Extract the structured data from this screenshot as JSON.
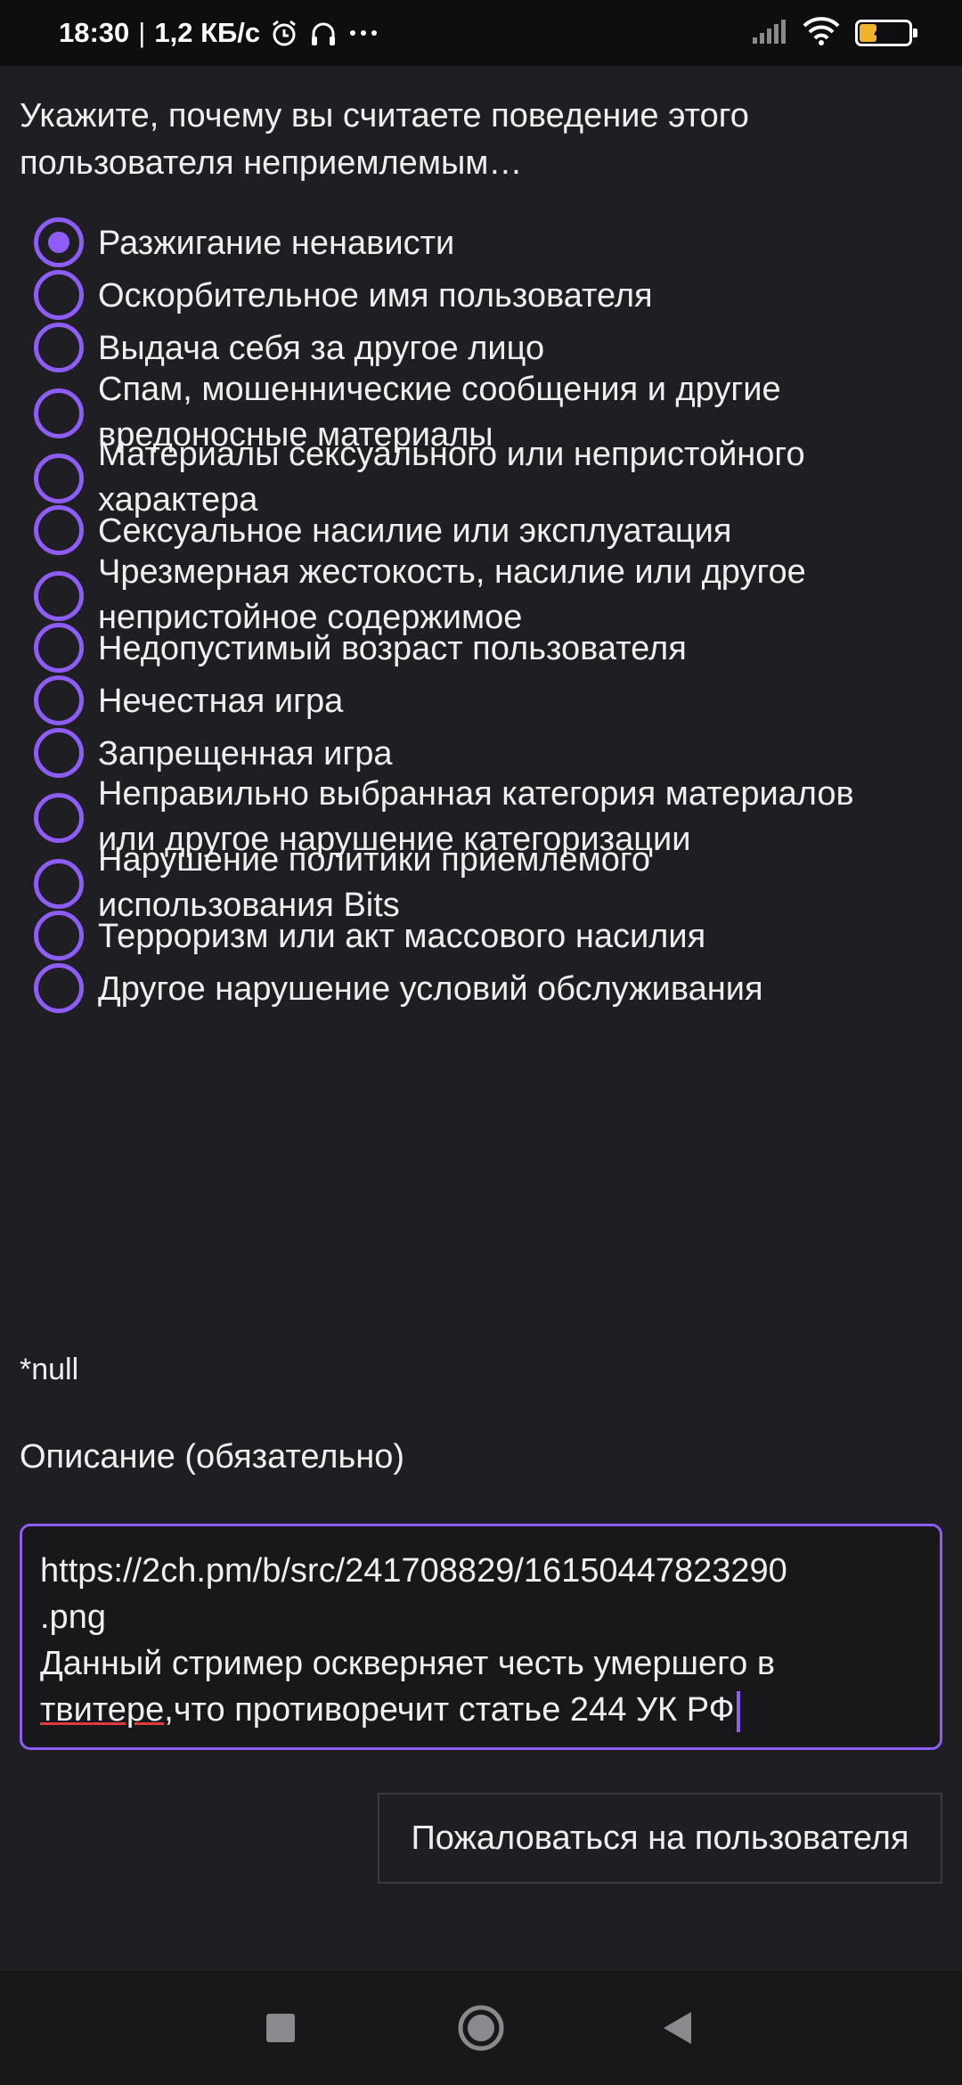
{
  "status_bar": {
    "time": "18:30",
    "network_speed": "1,2 КБ/с",
    "battery_level": "40",
    "battery_fraction": 0.4
  },
  "prompt": {
    "line1": "Укажите, почему вы считаете поведение этого",
    "line2": "пользователя неприемлемым…"
  },
  "options": [
    {
      "label": "Разжигание ненависти",
      "checked": true
    },
    {
      "label": "Оскорбительное имя пользователя",
      "checked": false
    },
    {
      "label": "Выдача себя за другое лицо",
      "checked": false
    },
    {
      "label_line1": "Спам, мошеннические сообщения и другие",
      "label_line2": "вредоносные материалы",
      "checked": false
    },
    {
      "label_line1": "Материалы сексуального или непристойного",
      "label_line2": "характера",
      "checked": false
    },
    {
      "label": "Сексуальное насилие или эксплуатация",
      "checked": false
    },
    {
      "label_line1": "Чрезмерная жестокость, насилие или другое",
      "label_line2": "непристойное содержимое",
      "checked": false
    },
    {
      "label": "Недопустимый возраст пользователя",
      "checked": false
    },
    {
      "label": "Нечестная игра",
      "checked": false
    },
    {
      "label": "Запрещенная игра",
      "checked": false
    },
    {
      "label_line1": "Неправильно выбранная категория материалов",
      "label_line2": "или другое нарушение категоризации",
      "checked": false
    },
    {
      "label_line1": "Нарушение политики приемлемого",
      "label_line2": "использования Bits",
      "checked": false
    },
    {
      "label": "Терроризм или акт массового насилия",
      "checked": false
    },
    {
      "label": "Другое нарушение условий обслуживания",
      "checked": false
    }
  ],
  "required_note": "*null",
  "description": {
    "label": "Описание (обязательно)",
    "line1": "https://2ch.pm/b/src/241708829/16150447823290",
    "line2": ".png",
    "line3": "Данный стример оскверняет честь умершего в",
    "line4_misspelled": "твитере",
    "line4_rest": ",что противоречит статье 244 УК РФ"
  },
  "report_button": "Пожаловаться на пользователя",
  "colors": {
    "accent": "#8e5cf7",
    "background": "#1f1f23",
    "text": "#efeff1",
    "spellcheck": "#e0393e"
  },
  "icons": [
    "alarm-icon",
    "headphones-icon",
    "more-icon",
    "signal-icon",
    "wifi-icon",
    "battery-icon",
    "recents-icon",
    "home-icon",
    "back-icon"
  ]
}
